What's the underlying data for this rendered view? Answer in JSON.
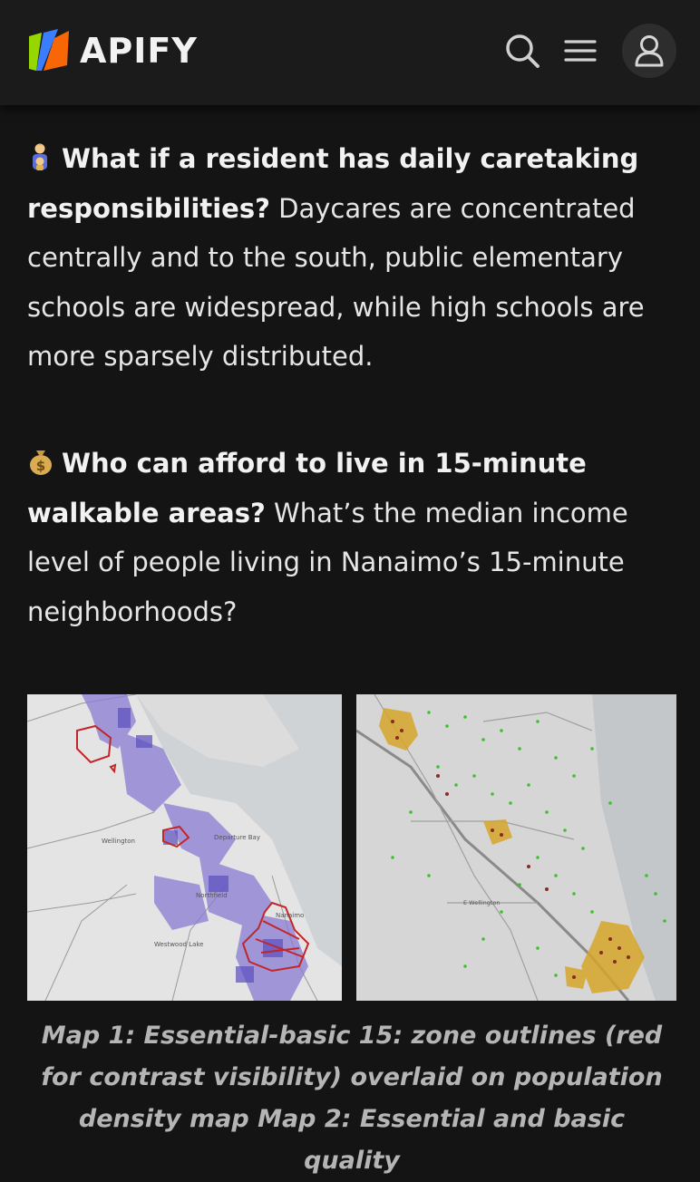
{
  "header": {
    "brand": "APIFY",
    "icons": [
      "apify-logo-icon",
      "search-icon",
      "menu-icon",
      "user-icon"
    ]
  },
  "article": {
    "p1": {
      "emoji": "caretaker-emoji-icon",
      "bold": "What if a resident has daily caretaking responsibilities?",
      "text": " Daycares are concentrated centrally and to the south, public elementary schools are widespread, while high schools are more sparsely distributed."
    },
    "p2": {
      "emoji": "money-bag-emoji-icon",
      "bold": "Who can afford to live in 15-minute walkable areas?",
      "text": " What’s the median income level of people living in Nanaimo’s 15-minute neighborhoods?"
    },
    "map1_labels": {
      "wellington": "Wellington",
      "departure_bay": "Departure Bay",
      "northfield": "Northfield",
      "westwood_lake": "Westwood Lake",
      "nanaimo": "Nanaimo"
    },
    "map2_labels": {
      "wellington": "E Wellington"
    },
    "caption": "Map 1: Essential-basic 15: zone outlines (red for contrast visibility) overlaid on population density map Map 2: Essential and basic quality"
  },
  "colors": {
    "background": "#141414",
    "header": "#1b1b1b",
    "accent_green": "#97d700",
    "accent_orange": "#f86606",
    "accent_blue": "#3a7dff"
  }
}
